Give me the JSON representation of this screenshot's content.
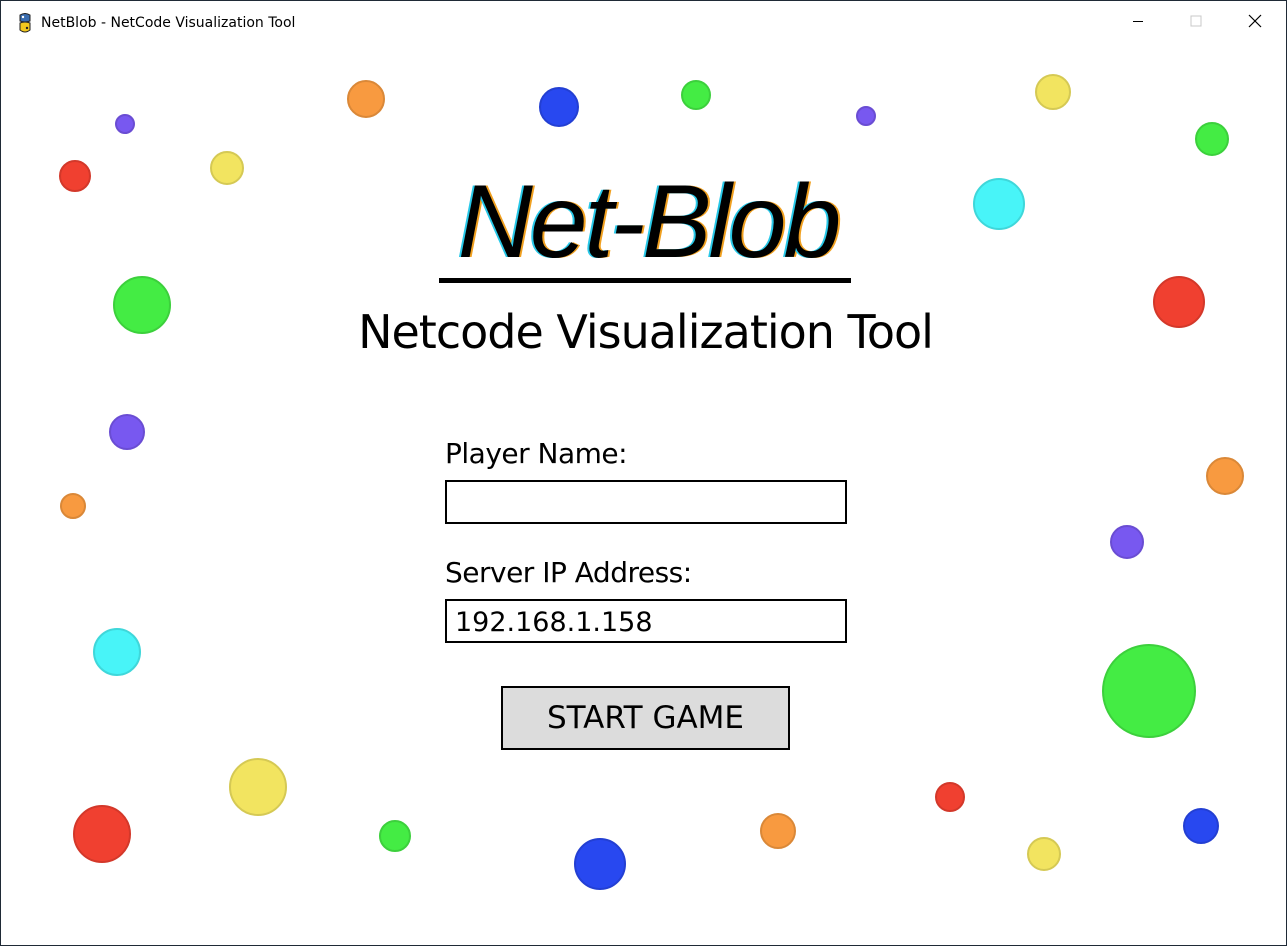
{
  "window": {
    "title": "NetBlob - NetCode Visualization Tool",
    "icon": "python-snake-icon",
    "controls": {
      "minimize_icon": "minimize-icon",
      "maximize_icon": "maximize-icon",
      "close_icon": "close-icon"
    }
  },
  "main": {
    "logo": "Net-Blob",
    "subtitle": "Netcode Visualization Tool",
    "player_name": {
      "label": "Player Name:",
      "value": ""
    },
    "server_ip": {
      "label": "Server IP Address:",
      "value": "192.168.1.158"
    },
    "start_button": "START GAME"
  },
  "colors": {
    "red": "#f04030",
    "orange": "#f89a40",
    "yellow": "#f2e460",
    "green": "#44ec44",
    "cyan": "#48f4f8",
    "blue": "#2848f0",
    "purple": "#7858f0",
    "button_bg": "#dcdcdc"
  }
}
